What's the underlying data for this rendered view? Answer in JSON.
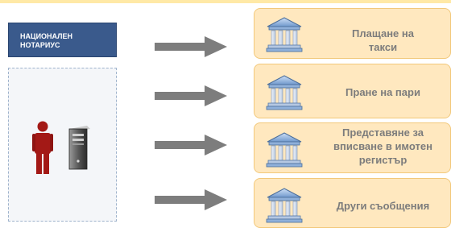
{
  "badge": {
    "line1": "НАЦИОНАЛЕН",
    "line2": "НОТАРИУС"
  },
  "icons": {
    "actor": "person-icon",
    "server": "server-icon",
    "bank": "bank-building-icon",
    "arrow": "arrow-right-icon"
  },
  "colors": {
    "badge_bg": "#3a5a8c",
    "box_bg": "#ffe8bf",
    "box_border": "#f2c87a",
    "arrow": "#7d7d7d",
    "person": "#a31916",
    "label_text": "#7c7c7c"
  },
  "targets": [
    {
      "lines": [
        "Плащане на",
        "такси"
      ]
    },
    {
      "lines": [
        "Пране на пари"
      ]
    },
    {
      "lines": [
        "Представяне за",
        "вписване в имотен",
        "регистър"
      ]
    },
    {
      "lines": [
        "Други съобщения"
      ]
    }
  ]
}
